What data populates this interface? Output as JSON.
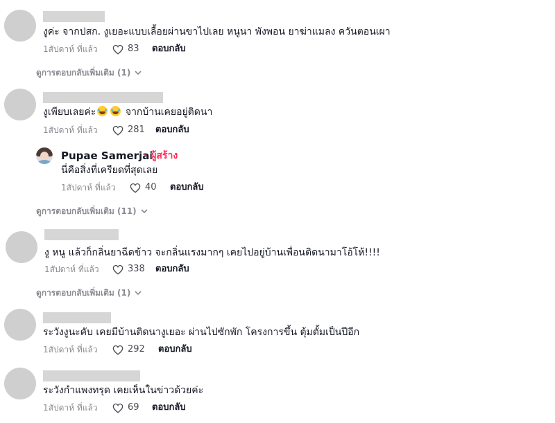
{
  "comments": [
    {
      "text": "งูค่ะ จากปสก. งูเยอะแบบเลื้อยผ่านขาไปเลย หนูนา พังพอน ยาฆ่าแมลง ควันตอนเผา",
      "time": "1สัปดาห์ ที่แล้ว",
      "likes": "83",
      "reply": "ตอบกลับ",
      "more_replies": "ดูการตอบกลับเพิ่มเติม (1)"
    },
    {
      "text_before": "งูเพียบเลยค่ะ",
      "emoji": "grinning-face-with-tears-icon",
      "text_after": "จากบ้านเคยอยู่ติดนา",
      "time": "1สัปดาห์ ที่แล้ว",
      "likes": "281",
      "reply": "ตอบกลับ",
      "author_reply": {
        "name": "Pupae Samerjai",
        "badge": "· ผู้สร้าง",
        "text": "นี่คือสิ่งที่เครียดที่สุดเลย",
        "time": "1สัปดาห์ ที่แล้ว",
        "likes": "40",
        "reply": "ตอบกลับ"
      },
      "more_replies": "ดูการตอบกลับเพิ่มเติม (11)"
    },
    {
      "text": "งู หนู แล้วก็กลิ่นยาฉีดข้าว จะกลิ่นแรงมากๆ เคยไปอยู่บ้านเพื่อนติดนามาโอ้โห้!!!!",
      "time": "1สัปดาห์ ที่แล้ว",
      "likes": "338",
      "reply": "ตอบกลับ",
      "more_replies": "ดูการตอบกลับเพิ่มเติม (1)"
    },
    {
      "text": "ระวังงูนะคับ เคยมีบ้านติดนางูเยอะ ผ่านไปซักพัก โครงการขึ้น ตุ้มตั้มเป็นปีอีก",
      "time": "1สัปดาห์ ที่แล้ว",
      "likes": "292",
      "reply": "ตอบกลับ"
    },
    {
      "text": "ระวังกำแพงทรุด เคยเห็นในข่าวด้วยค่ะ",
      "time": "1สัปดาห์ ที่แล้ว",
      "likes": "69",
      "reply": "ตอบกลับ"
    }
  ],
  "icons": {
    "like": "heart-outline-icon",
    "expand": "chevron-down-icon"
  },
  "colors": {
    "creator_badge": "#fe2c55",
    "meta_text": "#8a8b91",
    "placeholder": "#d6d6d6"
  }
}
